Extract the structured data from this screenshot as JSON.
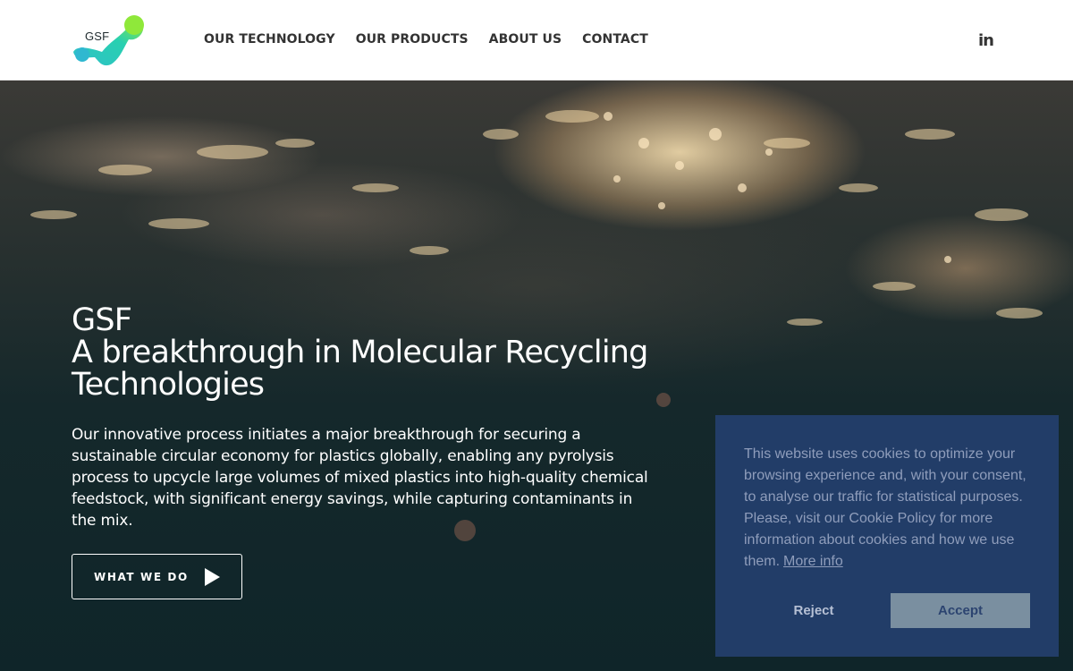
{
  "header": {
    "logo_text": "GSF",
    "nav": [
      "OUR TECHNOLOGY",
      "OUR PRODUCTS",
      "ABOUT US",
      "CONTACT"
    ],
    "social": "in",
    "social_icon": "linkedin-icon"
  },
  "hero": {
    "title_lines": [
      "GSF",
      "A breakthrough in Molecular Recycling",
      "Technologies"
    ],
    "description": "Our innovative process initiates a major breakthrough for securing a sustainable circular economy for plastics globally, enabling any pyrolysis process to upcycle large volumes of mixed plastics into high-quality chemical feedstock, with significant energy savings, while capturing contaminants in the mix.",
    "cta_label": "WHAT WE DO",
    "cta_icon": "play-arrow-icon"
  },
  "cookie": {
    "message": "This website uses cookies to optimize your browsing experience and, with your consent, to analyse our traffic for statistical purposes. Please, visit our Cookie Policy for more information about cookies and how we use them.",
    "link_text": "More info",
    "reject_label": "Reject",
    "accept_label": "Accept"
  },
  "colors": {
    "logo_gradient_start": "#2fc0c9",
    "logo_gradient_end": "#8fe83a",
    "cookie_bg": "#243f6e",
    "accept_bg": "#7a8fa0"
  }
}
